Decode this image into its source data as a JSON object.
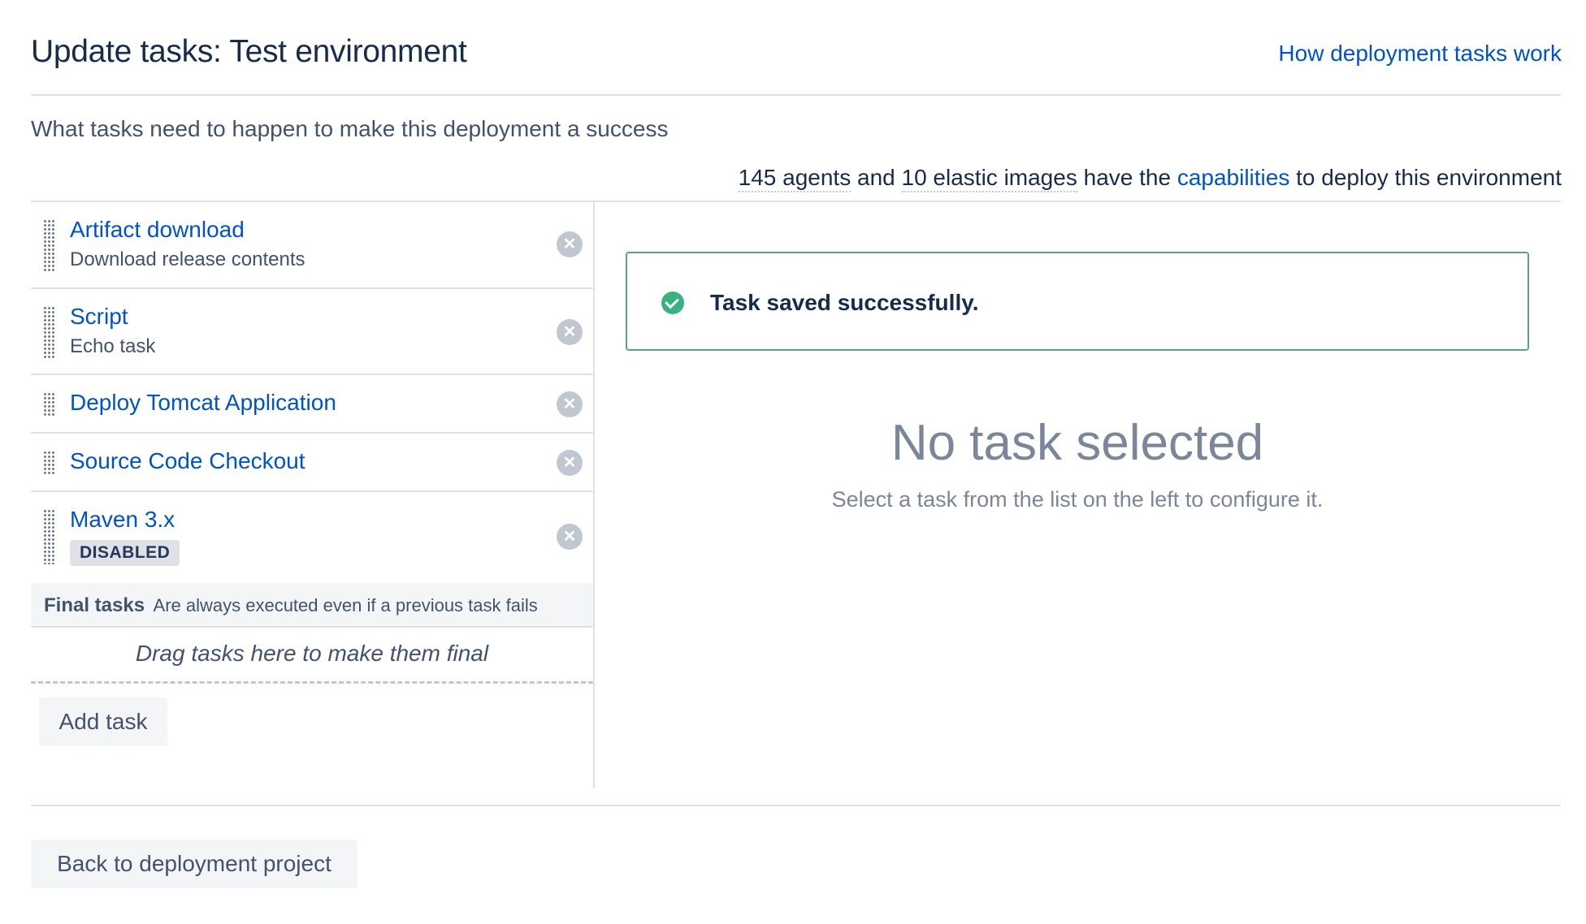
{
  "header": {
    "title": "Update tasks: Test environment",
    "help_link": "How deployment tasks work"
  },
  "description": "What tasks need to happen to make this deployment a success",
  "capabilities": {
    "agents": "145 agents",
    "and": "and",
    "images": "10 elastic images",
    "have_the": "have the",
    "link": "capabilities",
    "suffix": "to deploy this environment"
  },
  "tasks": [
    {
      "name": "Artifact download",
      "subtitle": "Download release contents"
    },
    {
      "name": "Script",
      "subtitle": "Echo task"
    },
    {
      "name": "Deploy Tomcat Application"
    },
    {
      "name": "Source Code Checkout"
    },
    {
      "name": "Maven 3.x",
      "badge": "DISABLED"
    }
  ],
  "final_tasks": {
    "label": "Final tasks",
    "description": "Are always executed even if a previous task fails",
    "drop_hint": "Drag tasks here to make them final"
  },
  "add_task_label": "Add task",
  "message": {
    "text": "Task saved successfully."
  },
  "empty_state": {
    "title": "No task selected",
    "subtitle": "Select a task from the list on the left to configure it."
  },
  "footer": {
    "back_label": "Back to deployment project"
  },
  "icons": {
    "remove": "close-circle-icon",
    "success": "check-circle-icon",
    "drag": "drag-handle-icon"
  },
  "colors": {
    "link": "#0052CC",
    "success": "#36B37E",
    "text": "#172B4D"
  }
}
